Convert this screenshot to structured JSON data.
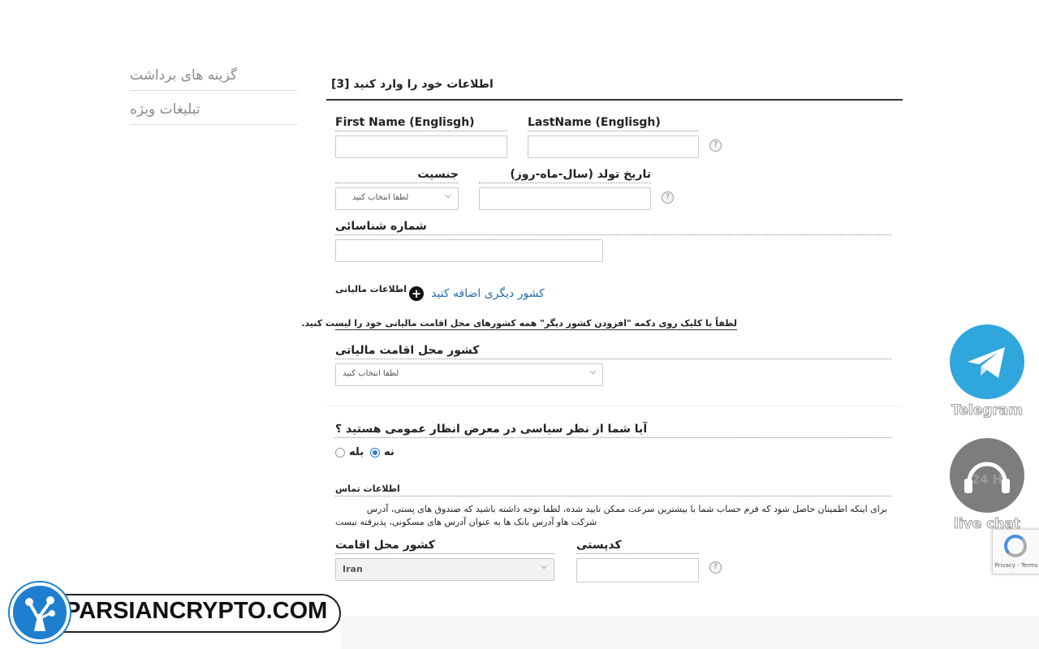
{
  "sidebar": {
    "items": [
      {
        "label": "گزینه های برداشت"
      },
      {
        "label": "تبلیغات ویژه"
      }
    ]
  },
  "form": {
    "title": "اطلاعات خود را وارد کنید [3]",
    "first_name_label": "First Name (Englisgh)",
    "last_name_label": "LastName (Englisgh)",
    "gender_label": "جنسیت",
    "gender_placeholder": "لطفا انتخاب کنید",
    "birthdate_label": "تاریخ تولد (سال-ماه-روز)",
    "id_number_label": "شماره شناسائی",
    "tax_info_label": "اطلاعات مالیاتی",
    "add_country_link": "کشور دیگری اضافه کنید",
    "tax_instruction": "لطفاً با کلیک روی دکمه \"افزودن کشور دیگر\" همه کشورهای محل اقامت مالیاتی خود را لیست کنید.",
    "tax_country_label": "کشور محل اقامت مالیاتی",
    "tax_country_placeholder": "لطفا انتخاب کنید",
    "pep_question": "آیا شما از نظر سیاسی در معرض انظار عمومی هستید ؟",
    "pep_yes": "بله",
    "pep_no": "نه",
    "pep_selected": "no",
    "contact_label": "اطلاعات تماس",
    "contact_note_1": "برای اینکه اطمینان حاصل شود که فرم حساب شما با بیشترین سرعت ممکن تایید شده، لطفا توجه داشته باشید که صندوق های پستی، آدرس",
    "contact_note_2": "شرکت هاو آدرس بانک ها به عنوان آدرس های مسکونی، پذیرفته نیست",
    "residence_label": "کشور محل اقامت",
    "residence_value": "Iran",
    "postal_label": "کدپستی",
    "help_glyph": "?"
  },
  "floating": {
    "telegram_label": "Telegram",
    "livechat_label": "live chat",
    "livechat_badge": "24 H",
    "recaptcha_text": "Privacy - Terms"
  },
  "watermark": {
    "text": "PARSIANCRYPTO.COM"
  },
  "colors": {
    "telegram": "#2fa6dc",
    "livechat": "#7d7d7d",
    "radio_on": "#2a7ad5",
    "link": "#2a6fb0"
  }
}
